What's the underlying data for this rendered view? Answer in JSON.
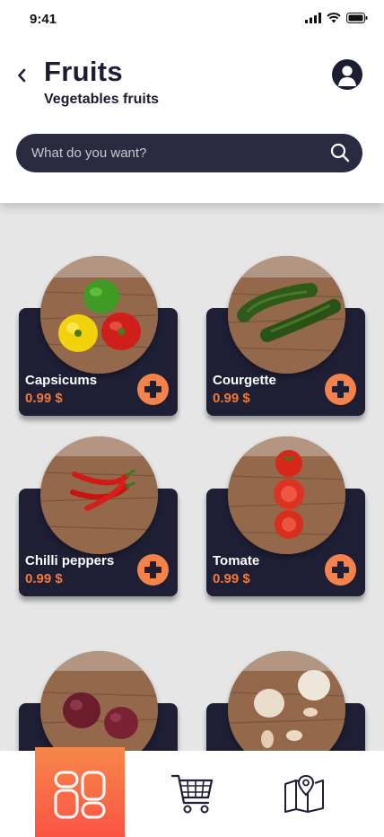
{
  "status_bar": {
    "time": "9:41"
  },
  "header": {
    "title": "Fruits",
    "subtitle": "Vegetables fruits"
  },
  "search": {
    "placeholder": "What do you want?"
  },
  "products": [
    {
      "name": "Capsicums",
      "price": "0.99 $"
    },
    {
      "name": "Courgette",
      "price": "0.99 $"
    },
    {
      "name": "Chilli peppers",
      "price": "0.99 $"
    },
    {
      "name": "Tomate",
      "price": "0.99 $"
    },
    {
      "name": "",
      "price": ""
    },
    {
      "name": "",
      "price": ""
    }
  ],
  "nav": {
    "items": [
      "home-icon",
      "cart-icon",
      "map-icon"
    ]
  },
  "colors": {
    "accent": "#f47a34",
    "card": "#1e1e35",
    "dark": "#1c1c33"
  }
}
